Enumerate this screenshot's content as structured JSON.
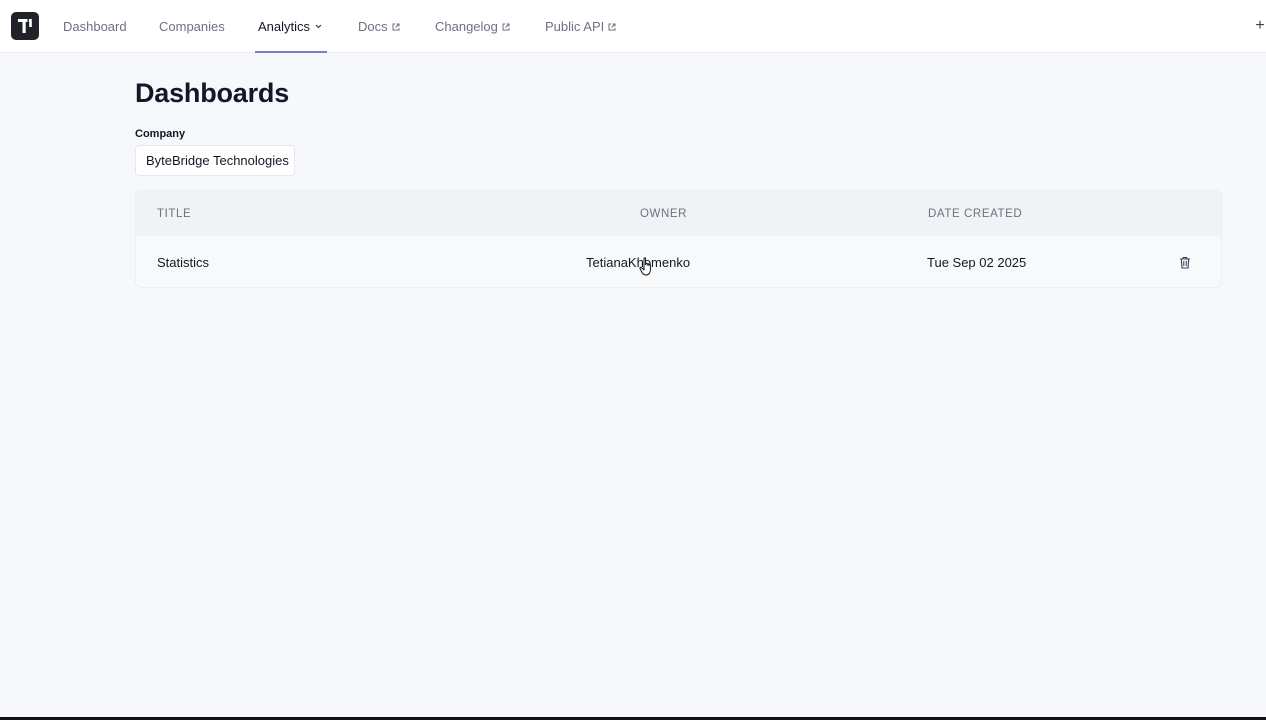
{
  "nav": {
    "items": [
      {
        "label": "Dashboard",
        "external": false
      },
      {
        "label": "Companies",
        "external": false
      },
      {
        "label": "Analytics",
        "external": false,
        "dropdown": true,
        "active": true
      },
      {
        "label": "Docs",
        "external": true
      },
      {
        "label": "Changelog",
        "external": true
      },
      {
        "label": "Public API",
        "external": true
      }
    ],
    "plus": "+"
  },
  "page": {
    "title": "Dashboards"
  },
  "filter": {
    "label": "Company",
    "value": "ByteBridge Technologies"
  },
  "table": {
    "headers": {
      "title": "TITLE",
      "owner": "OWNER",
      "date_created": "DATE CREATED"
    },
    "rows": [
      {
        "title": "Statistics",
        "owner": "TetianaKhomenko",
        "date_created": "Tue Sep 02 2025"
      }
    ]
  },
  "colors": {
    "accent_underline": "#7b7fc9",
    "logo_bg": "#1f2328"
  }
}
